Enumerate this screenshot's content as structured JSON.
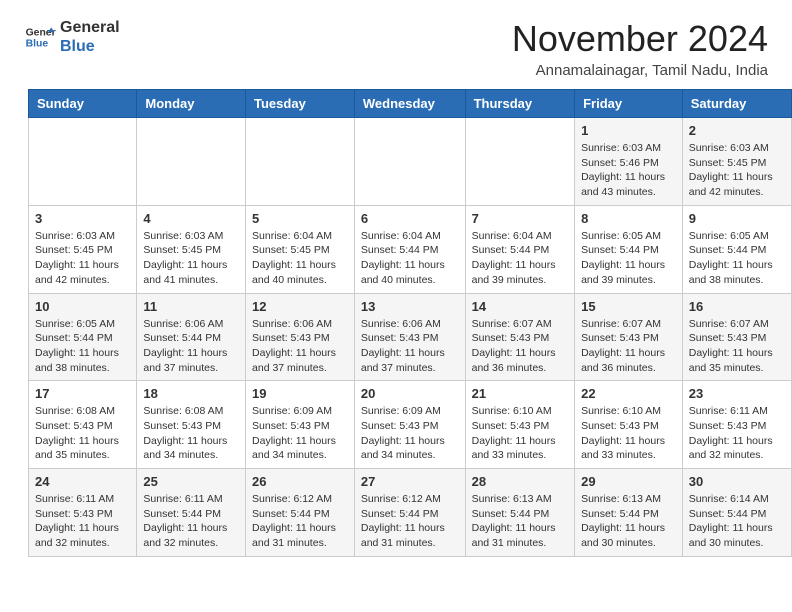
{
  "header": {
    "logo": {
      "general": "General",
      "blue": "Blue"
    },
    "title": "November 2024",
    "location": "Annamalainagar, Tamil Nadu, India"
  },
  "calendar": {
    "days_of_week": [
      "Sunday",
      "Monday",
      "Tuesday",
      "Wednesday",
      "Thursday",
      "Friday",
      "Saturday"
    ],
    "weeks": [
      [
        {
          "day": "",
          "info": ""
        },
        {
          "day": "",
          "info": ""
        },
        {
          "day": "",
          "info": ""
        },
        {
          "day": "",
          "info": ""
        },
        {
          "day": "",
          "info": ""
        },
        {
          "day": "1",
          "info": "Sunrise: 6:03 AM\nSunset: 5:46 PM\nDaylight: 11 hours and 43 minutes."
        },
        {
          "day": "2",
          "info": "Sunrise: 6:03 AM\nSunset: 5:45 PM\nDaylight: 11 hours and 42 minutes."
        }
      ],
      [
        {
          "day": "3",
          "info": "Sunrise: 6:03 AM\nSunset: 5:45 PM\nDaylight: 11 hours and 42 minutes."
        },
        {
          "day": "4",
          "info": "Sunrise: 6:03 AM\nSunset: 5:45 PM\nDaylight: 11 hours and 41 minutes."
        },
        {
          "day": "5",
          "info": "Sunrise: 6:04 AM\nSunset: 5:45 PM\nDaylight: 11 hours and 40 minutes."
        },
        {
          "day": "6",
          "info": "Sunrise: 6:04 AM\nSunset: 5:44 PM\nDaylight: 11 hours and 40 minutes."
        },
        {
          "day": "7",
          "info": "Sunrise: 6:04 AM\nSunset: 5:44 PM\nDaylight: 11 hours and 39 minutes."
        },
        {
          "day": "8",
          "info": "Sunrise: 6:05 AM\nSunset: 5:44 PM\nDaylight: 11 hours and 39 minutes."
        },
        {
          "day": "9",
          "info": "Sunrise: 6:05 AM\nSunset: 5:44 PM\nDaylight: 11 hours and 38 minutes."
        }
      ],
      [
        {
          "day": "10",
          "info": "Sunrise: 6:05 AM\nSunset: 5:44 PM\nDaylight: 11 hours and 38 minutes."
        },
        {
          "day": "11",
          "info": "Sunrise: 6:06 AM\nSunset: 5:44 PM\nDaylight: 11 hours and 37 minutes."
        },
        {
          "day": "12",
          "info": "Sunrise: 6:06 AM\nSunset: 5:43 PM\nDaylight: 11 hours and 37 minutes."
        },
        {
          "day": "13",
          "info": "Sunrise: 6:06 AM\nSunset: 5:43 PM\nDaylight: 11 hours and 37 minutes."
        },
        {
          "day": "14",
          "info": "Sunrise: 6:07 AM\nSunset: 5:43 PM\nDaylight: 11 hours and 36 minutes."
        },
        {
          "day": "15",
          "info": "Sunrise: 6:07 AM\nSunset: 5:43 PM\nDaylight: 11 hours and 36 minutes."
        },
        {
          "day": "16",
          "info": "Sunrise: 6:07 AM\nSunset: 5:43 PM\nDaylight: 11 hours and 35 minutes."
        }
      ],
      [
        {
          "day": "17",
          "info": "Sunrise: 6:08 AM\nSunset: 5:43 PM\nDaylight: 11 hours and 35 minutes."
        },
        {
          "day": "18",
          "info": "Sunrise: 6:08 AM\nSunset: 5:43 PM\nDaylight: 11 hours and 34 minutes."
        },
        {
          "day": "19",
          "info": "Sunrise: 6:09 AM\nSunset: 5:43 PM\nDaylight: 11 hours and 34 minutes."
        },
        {
          "day": "20",
          "info": "Sunrise: 6:09 AM\nSunset: 5:43 PM\nDaylight: 11 hours and 34 minutes."
        },
        {
          "day": "21",
          "info": "Sunrise: 6:10 AM\nSunset: 5:43 PM\nDaylight: 11 hours and 33 minutes."
        },
        {
          "day": "22",
          "info": "Sunrise: 6:10 AM\nSunset: 5:43 PM\nDaylight: 11 hours and 33 minutes."
        },
        {
          "day": "23",
          "info": "Sunrise: 6:11 AM\nSunset: 5:43 PM\nDaylight: 11 hours and 32 minutes."
        }
      ],
      [
        {
          "day": "24",
          "info": "Sunrise: 6:11 AM\nSunset: 5:43 PM\nDaylight: 11 hours and 32 minutes."
        },
        {
          "day": "25",
          "info": "Sunrise: 6:11 AM\nSunset: 5:44 PM\nDaylight: 11 hours and 32 minutes."
        },
        {
          "day": "26",
          "info": "Sunrise: 6:12 AM\nSunset: 5:44 PM\nDaylight: 11 hours and 31 minutes."
        },
        {
          "day": "27",
          "info": "Sunrise: 6:12 AM\nSunset: 5:44 PM\nDaylight: 11 hours and 31 minutes."
        },
        {
          "day": "28",
          "info": "Sunrise: 6:13 AM\nSunset: 5:44 PM\nDaylight: 11 hours and 31 minutes."
        },
        {
          "day": "29",
          "info": "Sunrise: 6:13 AM\nSunset: 5:44 PM\nDaylight: 11 hours and 30 minutes."
        },
        {
          "day": "30",
          "info": "Sunrise: 6:14 AM\nSunset: 5:44 PM\nDaylight: 11 hours and 30 minutes."
        }
      ]
    ]
  }
}
